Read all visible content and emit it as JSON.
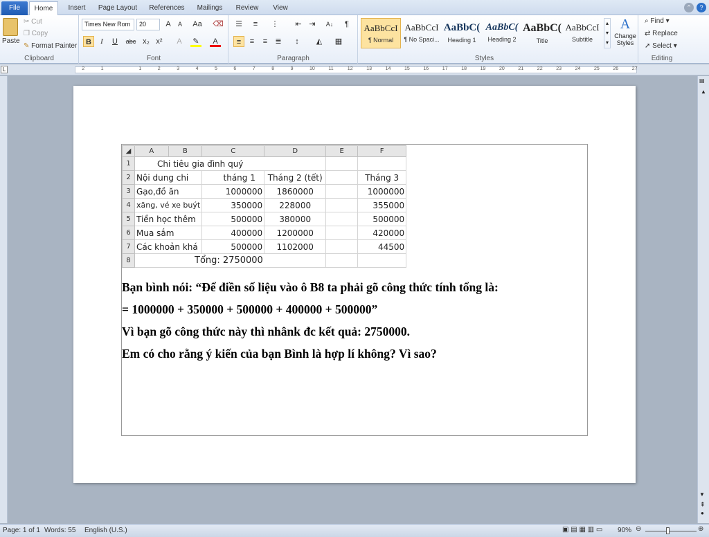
{
  "tabs": [
    "File",
    "Home",
    "Insert",
    "Page Layout",
    "References",
    "Mailings",
    "Review",
    "View"
  ],
  "clipboard": {
    "paste": "Paste",
    "cut": "Cut",
    "copy": "Copy",
    "format_painter": "Format Painter",
    "label": "Clipboard"
  },
  "font": {
    "name": "Times New Rom",
    "size": "20",
    "label": "Font"
  },
  "paragraph": {
    "label": "Paragraph"
  },
  "styles": {
    "label": "Styles",
    "items": [
      {
        "preview": "AaBbCcI",
        "name": "¶ Normal"
      },
      {
        "preview": "AaBbCcI",
        "name": "¶ No Spaci..."
      },
      {
        "preview": "AaBbC(",
        "name": "Heading 1"
      },
      {
        "preview": "AaBbC(",
        "name": "Heading 2"
      },
      {
        "preview": "AaBbC(",
        "name": "Title"
      },
      {
        "preview": "AaBbCcI",
        "name": "Subtitle"
      }
    ],
    "change": "Change Styles"
  },
  "editing": {
    "find": "Find",
    "replace": "Replace",
    "select": "Select",
    "label": "Editing"
  },
  "sheet": {
    "cols": [
      "A",
      "B",
      "C",
      "D",
      "E",
      "F"
    ],
    "title": "Chi tiêu gia đình quý",
    "header": [
      "Nội dung chi",
      "tháng 1",
      "Tháng 2 (tết)",
      "Tháng 3"
    ],
    "rows": [
      [
        "Gạo,đồ ăn",
        "1000000",
        "1860000",
        "1000000"
      ],
      [
        "xăng, vé xe buýt",
        "350000",
        "228000",
        "355000"
      ],
      [
        "Tiền học thêm",
        "500000",
        "380000",
        "500000"
      ],
      [
        "Mua sắm",
        "400000",
        "1200000",
        "420000"
      ],
      [
        "Các khoản khá",
        "500000",
        "1102000",
        "44500"
      ]
    ],
    "total": "Tổng: 2750000"
  },
  "body": [
    "Bạn bình nói: “Để điền số liệu vào ô B8 ta phải gõ công thức tính tổng là:",
    "= 1000000 + 350000 + 500000 + 400000 + 500000”",
    "Vì bạn gõ công thức này thì nhânk đc kết quả: 2750000.",
    "Em có cho rằng ý kiến của bạn Bình là hợp lí không? Vì sao?"
  ],
  "status": {
    "page": "Page: 1 of 1",
    "words": "Words: 55",
    "lang": "English (U.S.)",
    "zoom": "90%"
  }
}
